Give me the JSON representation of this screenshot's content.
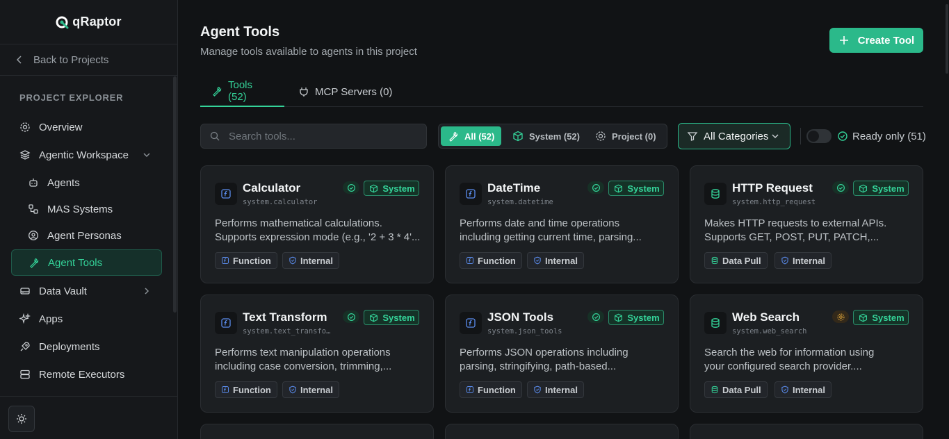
{
  "app": {
    "name": "qRaptor"
  },
  "sidebar": {
    "back_label": "Back to Projects",
    "section_label": "PROJECT EXPLORER",
    "items": [
      {
        "label": "Overview",
        "icon": "gear-icon"
      },
      {
        "label": "Agentic Workspace",
        "icon": "layers-icon"
      },
      {
        "label": "Agents",
        "icon": "bot-icon"
      },
      {
        "label": "MAS Systems",
        "icon": "workflow-icon"
      },
      {
        "label": "Agent Personas",
        "icon": "user-circle-icon"
      },
      {
        "label": "Agent Tools",
        "icon": "wrench-icon"
      },
      {
        "label": "Data Vault",
        "icon": "hard-drive-icon"
      },
      {
        "label": "Apps",
        "icon": "sparkles-icon"
      },
      {
        "label": "Deployments",
        "icon": "rocket-icon"
      },
      {
        "label": "Remote Executors",
        "icon": "server-icon"
      }
    ]
  },
  "header": {
    "title": "Agent Tools",
    "subtitle": "Manage tools available to agents in this project",
    "create_label": "Create Tool"
  },
  "tabs": [
    {
      "label": "Tools (52)"
    },
    {
      "label": "MCP Servers (0)"
    }
  ],
  "filters": {
    "search_placeholder": "Search tools...",
    "segments": [
      {
        "label": "All (52)"
      },
      {
        "label": "System (52)"
      },
      {
        "label": "Project (0)"
      }
    ],
    "category_label": "All Categories",
    "ready_label": "Ready only (51)"
  },
  "colors": {
    "accent": "#2bb98a",
    "accent_text": "#34d399",
    "function_blue": "#5b8def",
    "warning": "#d9a23a"
  },
  "cards": [
    {
      "title": "Calculator",
      "id": "system.calculator",
      "desc1": "Performs mathematical calculations.",
      "desc2": "Supports expression mode (e.g., '2 + 3 * 4'...",
      "badge": "System",
      "tag1": "Function",
      "tag2": "Internal"
    },
    {
      "title": "DateTime",
      "id": "system.datetime",
      "desc1": "Performs date and time operations",
      "desc2": "including getting current time, parsing...",
      "badge": "System",
      "tag1": "Function",
      "tag2": "Internal"
    },
    {
      "title": "HTTP Request",
      "id": "system.http_request",
      "desc1": "Makes HTTP requests to external APIs.",
      "desc2": "Supports GET, POST, PUT, PATCH,...",
      "badge": "System",
      "tag1": "Data Pull",
      "tag2": "Internal"
    },
    {
      "title": "Text Transform",
      "id": "system.text_transfo…",
      "desc1": "Performs text manipulation operations",
      "desc2": "including case conversion, trimming,...",
      "badge": "System",
      "tag1": "Function",
      "tag2": "Internal"
    },
    {
      "title": "JSON Tools",
      "id": "system.json_tools",
      "desc1": "Performs JSON operations including",
      "desc2": "parsing, stringifying, path-based...",
      "badge": "System",
      "tag1": "Function",
      "tag2": "Internal"
    },
    {
      "title": "Web Search",
      "id": "system.web_search",
      "desc1": "Search the web for information using",
      "desc2": "your configured search provider....",
      "badge": "System",
      "tag1": "Data Pull",
      "tag2": "Internal"
    }
  ]
}
